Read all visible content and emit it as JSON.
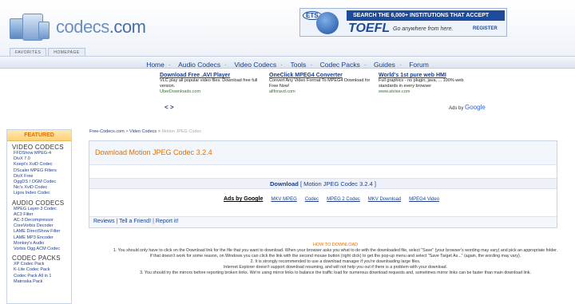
{
  "site": {
    "logo_text": "codecs",
    "logo_suffix": ".com"
  },
  "banner": {
    "ets": "ETS",
    "headline": "SEARCH THE 6,000+ INSTITUTIONS THAT ACCEPT TOEFL",
    "brand": "TOEFL",
    "tagline": "Go anywhere from here.",
    "register": "REGISTER"
  },
  "top_tabs": [
    "FAVORITES",
    "HOMEPAGE"
  ],
  "nav": [
    "Home",
    "Audio Codecs",
    "Video Codecs",
    "Tools",
    "Codec Packs",
    "Guides",
    "Forum"
  ],
  "ads": [
    {
      "title": "Download Free .AVI Player",
      "desc": "VLC play all popular video files. Download free full version.",
      "url": "UberDownloads.com"
    },
    {
      "title": "OneClick MPEG4 Converter",
      "desc": "Convert Any Video Format To MPEG4 Download for Free Now!",
      "url": "allforavd.com"
    },
    {
      "title": "World's 1st pure web HMI",
      "desc": "Full graphics - no plugin, java, ... 100% web standards in every browser",
      "url": "www.atvise.com"
    }
  ],
  "ads_arrows": "< >",
  "ads_by_label": "Ads by",
  "ads_by_brand": "Google",
  "sidebar": {
    "featured": "FEATURED",
    "sections": [
      {
        "title": "VIDEO CODECS",
        "items": [
          "FFDShow MPEG-4",
          "DivX 7.0",
          "Koepi's XviD Codec",
          "DScaler MPEG Filters",
          "DivX Free",
          "OggDS / OGM Codec",
          "Nic's XviD Codec",
          "Ligos Indeo Codec"
        ]
      },
      {
        "title": "AUDIO CODECS",
        "items": [
          "MPEG Layer-3 Codec",
          "AC3 Filter",
          "AC-3 Decompressor",
          "CoreVorbis Decoder",
          "LAME DirectShow Filter",
          "LAME MP3 Encoder",
          "Monkey's Audio",
          "Vorbis Ogg ACM Codec"
        ]
      },
      {
        "title": "CODEC PACKS",
        "items": [
          "XP Codec Pack",
          "K-Lite Codec Pack",
          "Codec Pack All in 1",
          "Matroska Pack"
        ]
      }
    ]
  },
  "breadcrumb": {
    "home": "Free-Codecs.com",
    "sep": ">",
    "section": "Video Codecs",
    "current": "Motion JPEG Codec"
  },
  "content": {
    "title": "Download Motion JPEG Codec 3.2.4",
    "download_label": "Download",
    "download_bracket": "[ Motion JPEG Codec 3.2.4 ]",
    "ads_by": "Ads by Google",
    "link_ads": [
      "MKV MPEG",
      "Codec",
      "MPEG 2 Codec",
      "MKV Download",
      "MPEG4 Video"
    ],
    "footer": {
      "reviews": "Reviews",
      "tell": "Tell a Friend!",
      "report": "Report it!",
      "sep": "|"
    }
  },
  "howto": {
    "title": "HOW TO DOWNLOAD",
    "lines": [
      "1. You should only have to click on the Download link for the file that you want to download. When your browser asks you what to do with the downloaded file, select \"Save\" (your browser's wording may vary) and pick an appropriate folder.",
      "If that doesn't work for some reason, on Windows you can click the link with the second mouse button (right click) to get the pop-up menu and select \"Save Target As...\" (again, the wording may vary).",
      "2. It is strongly recommended to use a download manager if you're downloading large files.",
      "Internet Explorer doesn't support download resuming, and will not help you out if there is a problem with your download.",
      "3. You should try the mirrors before reporting broken links. We're using mirror links to balance the traffic load for numerous download requests and, sometimes mirror links can be faster than main download link."
    ]
  }
}
